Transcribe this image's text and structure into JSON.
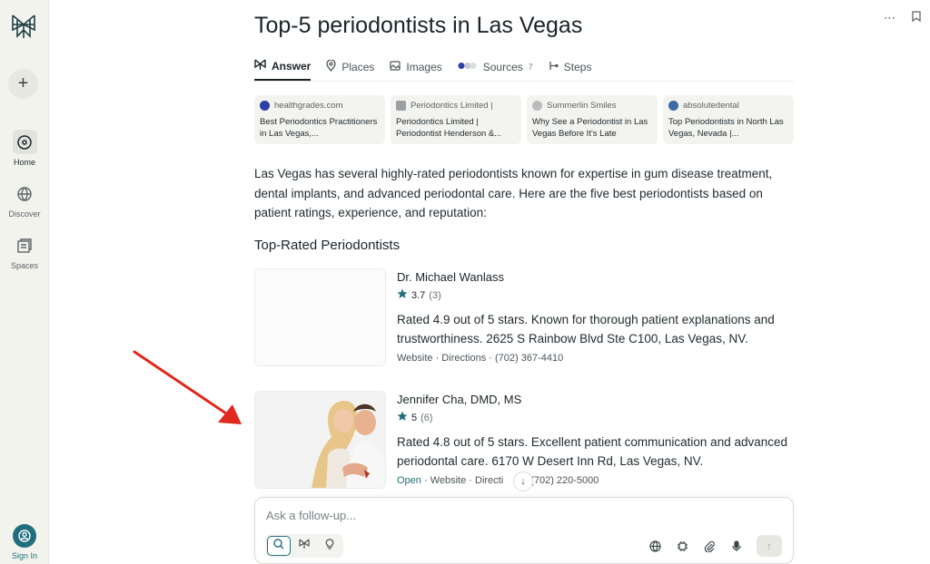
{
  "sidebar": {
    "new_label": "+",
    "nav": [
      {
        "label": "Home",
        "icon": "home-search-icon"
      },
      {
        "label": "Discover",
        "icon": "globe-icon"
      },
      {
        "label": "Spaces",
        "icon": "spaces-icon"
      }
    ],
    "sign_in": "Sign In"
  },
  "page": {
    "title": "Top-5 periodontists in Las Vegas"
  },
  "tabs": [
    {
      "label": "Answer",
      "icon": "answer-icon"
    },
    {
      "label": "Places",
      "icon": "pin-icon"
    },
    {
      "label": "Images",
      "icon": "image-icon"
    },
    {
      "label": "Sources",
      "icon": "sources-icon",
      "count": "7"
    },
    {
      "label": "Steps",
      "icon": "steps-icon"
    }
  ],
  "sources": [
    {
      "site": "healthgrades.com",
      "title": "Best Periodontics Practitioners in Las Vegas,...",
      "color": "#2d3eaa"
    },
    {
      "site": "Periodontics Limited |",
      "title": "Periodontics Limited | Periodontist Henderson &...",
      "color": "#9aa0a3"
    },
    {
      "site": "Summerlin Smiles",
      "title": "Why See a Periodontist in Las Vegas Before It's Late",
      "color": "#b8bcbe"
    },
    {
      "site": "absolutedental",
      "title": "Top Periodontists in North Las Vegas, Nevada |...",
      "color": "#3a6aa8"
    }
  ],
  "intro": "Las Vegas has several highly-rated periodontists known for expertise in gum disease treatment, dental implants, and advanced periodontal care. Here are the five best periodontists based on patient ratings, experience, and reputation:",
  "section_heading": "Top-Rated Periodontists",
  "places": [
    {
      "name": "Dr. Michael Wanlass",
      "rating": "3.7",
      "count": "(3)",
      "desc": "Rated 4.9 out of 5 stars. Known for thorough patient explanations and trustworthiness. 2625 S Rainbow Blvd Ste C100, Las Vegas, NV.",
      "links": "Website · Directions · (702) 367-4410"
    },
    {
      "name": "Jennifer Cha, DMD, MS",
      "rating": "5",
      "count": "(6)",
      "desc": "Rated 4.8 out of 5 stars. Excellent patient communication and advanced periodontal care. 6170 W Desert Inn Rd, Las Vegas, NV.",
      "open": "Open",
      "links": " · Website · Directi",
      "phone": "(702) 220-5000"
    }
  ],
  "ask": {
    "placeholder": "Ask a follow-up..."
  },
  "colors": {
    "accent": "#1f6f7c",
    "arrow": "#e0281e"
  }
}
